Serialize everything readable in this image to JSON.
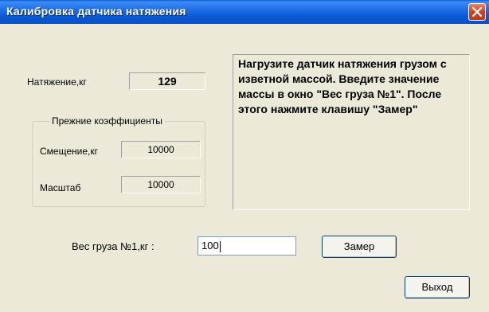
{
  "window": {
    "title": "Калибровка датчика натяжения",
    "close_icon": "close-x"
  },
  "tension": {
    "label": "Натяжение,кг",
    "value": "129"
  },
  "coefficients": {
    "legend": "Прежние коэффициенты",
    "offset_label": "Смещение,кг",
    "offset_value": "10000",
    "scale_label": "Масштаб",
    "scale_value": "10000"
  },
  "instructions": {
    "text": "Нагрузите датчик натяжения грузом с изветной массой. Введите значение массы в окно \"Вес груза №1\". После этого нажмите клавишу \"Замер\""
  },
  "weight": {
    "label": "Вес груза №1,кг :",
    "value": "100"
  },
  "buttons": {
    "measure": "Замер",
    "exit": "Выход"
  },
  "colors": {
    "titlebar": "#0a58d0",
    "window_bg": "#ece9d8",
    "close": "#d0411f"
  }
}
